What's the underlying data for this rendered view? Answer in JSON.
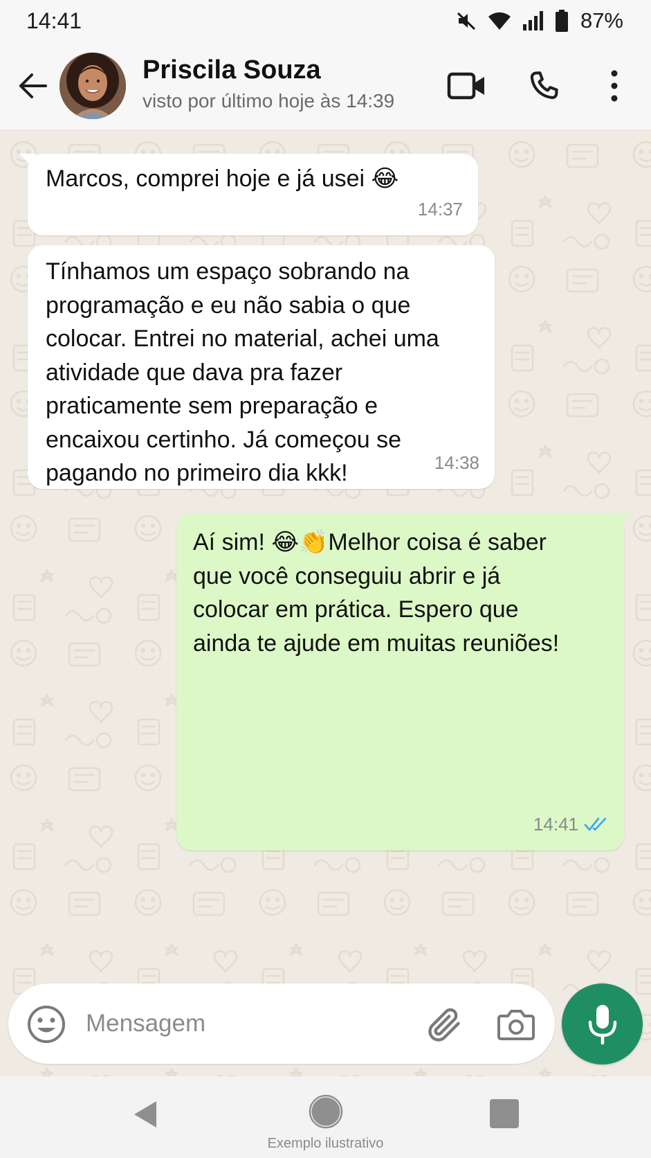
{
  "status_bar": {
    "time": "14:41",
    "battery": "87%",
    "icons": [
      "mute-icon",
      "wifi-icon",
      "signal-icon",
      "battery-icon"
    ]
  },
  "header": {
    "contact_name": "Priscila Souza",
    "last_seen": "visto por último hoje às 14:39",
    "icons": [
      "back-arrow-icon",
      "video-call-icon",
      "phone-icon",
      "more-vert-icon"
    ]
  },
  "messages": [
    {
      "direction": "incoming",
      "text": "Marcos, comprei hoje e já usei 😂",
      "time": "14:37"
    },
    {
      "direction": "incoming",
      "text": "Tínhamos um espaço sobrando na\nprogramação e eu não sabia o que\ncolocar. Entrei no material, achei uma\natividade que dava pra fazer\npraticamente sem preparação e\nencaixou certinho. Já começou se\npagando no primeiro dia kkk!",
      "time": "14:38"
    },
    {
      "direction": "outgoing",
      "text": "Aí sim! 😂👏Melhor coisa é saber\nque você conseguiu abrir e já\ncolocar em prática. Espero que\nainda te ajude em muitas reuniões!",
      "time": "14:41",
      "read_status": "read"
    }
  ],
  "composer": {
    "placeholder": "Mensagem",
    "value": "",
    "icons": [
      "emoji-icon",
      "attach-icon",
      "camera-icon",
      "mic-icon"
    ]
  },
  "nav": {
    "watermark": "Exemplo ilustrativo"
  },
  "colors": {
    "chat_background": "#efeae2",
    "incoming_bubble": "#ffffff",
    "outgoing_bubble": "#dcf8c6",
    "accent": "#1f8f63",
    "read_ticks": "#34a6f4"
  }
}
